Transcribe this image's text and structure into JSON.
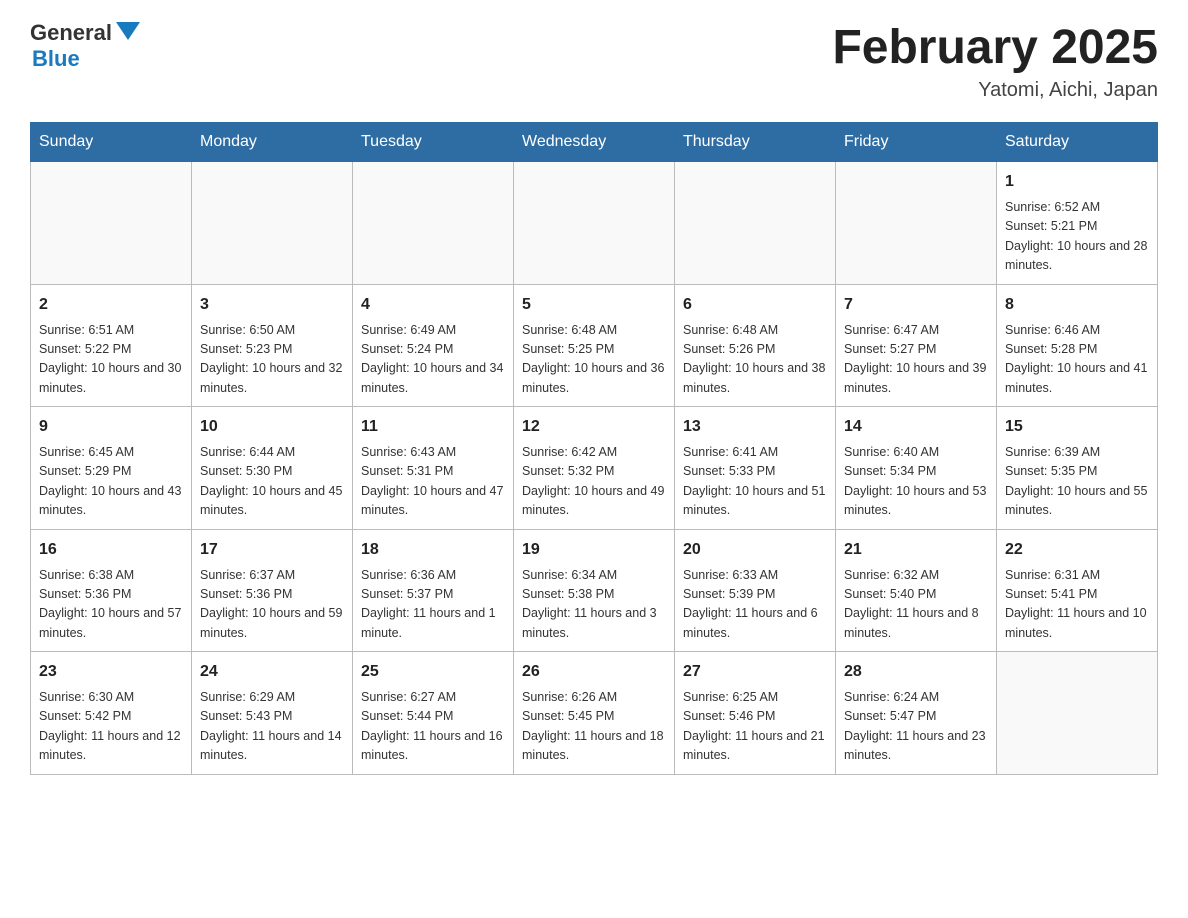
{
  "header": {
    "logo_general": "General",
    "logo_blue": "Blue",
    "month_title": "February 2025",
    "location": "Yatomi, Aichi, Japan"
  },
  "days_of_week": [
    "Sunday",
    "Monday",
    "Tuesday",
    "Wednesday",
    "Thursday",
    "Friday",
    "Saturday"
  ],
  "weeks": [
    [
      {
        "day": "",
        "sunrise": "",
        "sunset": "",
        "daylight": ""
      },
      {
        "day": "",
        "sunrise": "",
        "sunset": "",
        "daylight": ""
      },
      {
        "day": "",
        "sunrise": "",
        "sunset": "",
        "daylight": ""
      },
      {
        "day": "",
        "sunrise": "",
        "sunset": "",
        "daylight": ""
      },
      {
        "day": "",
        "sunrise": "",
        "sunset": "",
        "daylight": ""
      },
      {
        "day": "",
        "sunrise": "",
        "sunset": "",
        "daylight": ""
      },
      {
        "day": "1",
        "sunrise": "Sunrise: 6:52 AM",
        "sunset": "Sunset: 5:21 PM",
        "daylight": "Daylight: 10 hours and 28 minutes."
      }
    ],
    [
      {
        "day": "2",
        "sunrise": "Sunrise: 6:51 AM",
        "sunset": "Sunset: 5:22 PM",
        "daylight": "Daylight: 10 hours and 30 minutes."
      },
      {
        "day": "3",
        "sunrise": "Sunrise: 6:50 AM",
        "sunset": "Sunset: 5:23 PM",
        "daylight": "Daylight: 10 hours and 32 minutes."
      },
      {
        "day": "4",
        "sunrise": "Sunrise: 6:49 AM",
        "sunset": "Sunset: 5:24 PM",
        "daylight": "Daylight: 10 hours and 34 minutes."
      },
      {
        "day": "5",
        "sunrise": "Sunrise: 6:48 AM",
        "sunset": "Sunset: 5:25 PM",
        "daylight": "Daylight: 10 hours and 36 minutes."
      },
      {
        "day": "6",
        "sunrise": "Sunrise: 6:48 AM",
        "sunset": "Sunset: 5:26 PM",
        "daylight": "Daylight: 10 hours and 38 minutes."
      },
      {
        "day": "7",
        "sunrise": "Sunrise: 6:47 AM",
        "sunset": "Sunset: 5:27 PM",
        "daylight": "Daylight: 10 hours and 39 minutes."
      },
      {
        "day": "8",
        "sunrise": "Sunrise: 6:46 AM",
        "sunset": "Sunset: 5:28 PM",
        "daylight": "Daylight: 10 hours and 41 minutes."
      }
    ],
    [
      {
        "day": "9",
        "sunrise": "Sunrise: 6:45 AM",
        "sunset": "Sunset: 5:29 PM",
        "daylight": "Daylight: 10 hours and 43 minutes."
      },
      {
        "day": "10",
        "sunrise": "Sunrise: 6:44 AM",
        "sunset": "Sunset: 5:30 PM",
        "daylight": "Daylight: 10 hours and 45 minutes."
      },
      {
        "day": "11",
        "sunrise": "Sunrise: 6:43 AM",
        "sunset": "Sunset: 5:31 PM",
        "daylight": "Daylight: 10 hours and 47 minutes."
      },
      {
        "day": "12",
        "sunrise": "Sunrise: 6:42 AM",
        "sunset": "Sunset: 5:32 PM",
        "daylight": "Daylight: 10 hours and 49 minutes."
      },
      {
        "day": "13",
        "sunrise": "Sunrise: 6:41 AM",
        "sunset": "Sunset: 5:33 PM",
        "daylight": "Daylight: 10 hours and 51 minutes."
      },
      {
        "day": "14",
        "sunrise": "Sunrise: 6:40 AM",
        "sunset": "Sunset: 5:34 PM",
        "daylight": "Daylight: 10 hours and 53 minutes."
      },
      {
        "day": "15",
        "sunrise": "Sunrise: 6:39 AM",
        "sunset": "Sunset: 5:35 PM",
        "daylight": "Daylight: 10 hours and 55 minutes."
      }
    ],
    [
      {
        "day": "16",
        "sunrise": "Sunrise: 6:38 AM",
        "sunset": "Sunset: 5:36 PM",
        "daylight": "Daylight: 10 hours and 57 minutes."
      },
      {
        "day": "17",
        "sunrise": "Sunrise: 6:37 AM",
        "sunset": "Sunset: 5:36 PM",
        "daylight": "Daylight: 10 hours and 59 minutes."
      },
      {
        "day": "18",
        "sunrise": "Sunrise: 6:36 AM",
        "sunset": "Sunset: 5:37 PM",
        "daylight": "Daylight: 11 hours and 1 minute."
      },
      {
        "day": "19",
        "sunrise": "Sunrise: 6:34 AM",
        "sunset": "Sunset: 5:38 PM",
        "daylight": "Daylight: 11 hours and 3 minutes."
      },
      {
        "day": "20",
        "sunrise": "Sunrise: 6:33 AM",
        "sunset": "Sunset: 5:39 PM",
        "daylight": "Daylight: 11 hours and 6 minutes."
      },
      {
        "day": "21",
        "sunrise": "Sunrise: 6:32 AM",
        "sunset": "Sunset: 5:40 PM",
        "daylight": "Daylight: 11 hours and 8 minutes."
      },
      {
        "day": "22",
        "sunrise": "Sunrise: 6:31 AM",
        "sunset": "Sunset: 5:41 PM",
        "daylight": "Daylight: 11 hours and 10 minutes."
      }
    ],
    [
      {
        "day": "23",
        "sunrise": "Sunrise: 6:30 AM",
        "sunset": "Sunset: 5:42 PM",
        "daylight": "Daylight: 11 hours and 12 minutes."
      },
      {
        "day": "24",
        "sunrise": "Sunrise: 6:29 AM",
        "sunset": "Sunset: 5:43 PM",
        "daylight": "Daylight: 11 hours and 14 minutes."
      },
      {
        "day": "25",
        "sunrise": "Sunrise: 6:27 AM",
        "sunset": "Sunset: 5:44 PM",
        "daylight": "Daylight: 11 hours and 16 minutes."
      },
      {
        "day": "26",
        "sunrise": "Sunrise: 6:26 AM",
        "sunset": "Sunset: 5:45 PM",
        "daylight": "Daylight: 11 hours and 18 minutes."
      },
      {
        "day": "27",
        "sunrise": "Sunrise: 6:25 AM",
        "sunset": "Sunset: 5:46 PM",
        "daylight": "Daylight: 11 hours and 21 minutes."
      },
      {
        "day": "28",
        "sunrise": "Sunrise: 6:24 AM",
        "sunset": "Sunset: 5:47 PM",
        "daylight": "Daylight: 11 hours and 23 minutes."
      },
      {
        "day": "",
        "sunrise": "",
        "sunset": "",
        "daylight": ""
      }
    ]
  ]
}
